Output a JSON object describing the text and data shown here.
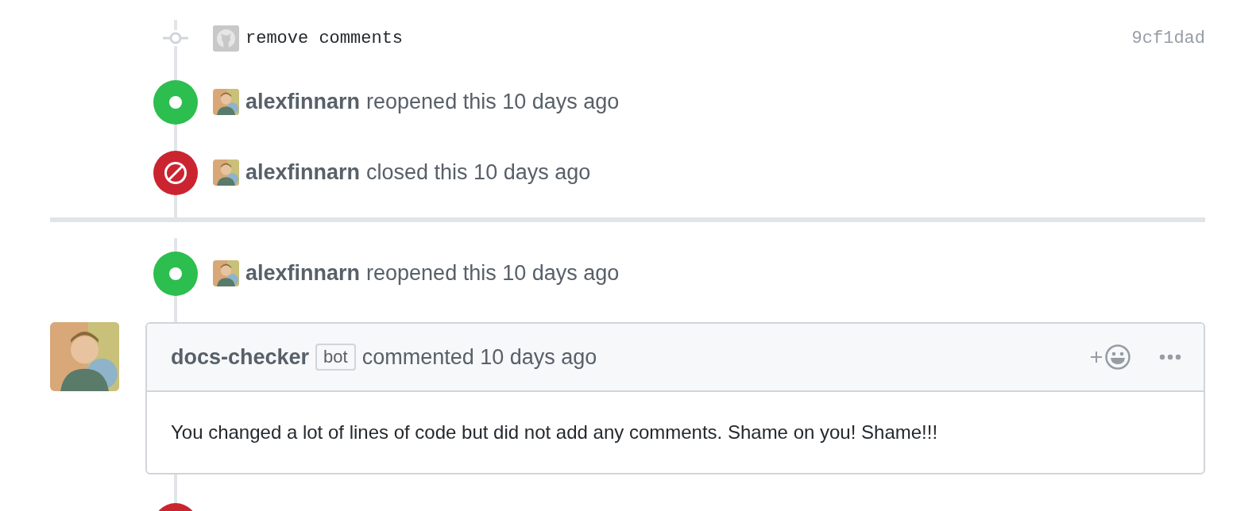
{
  "timeline": [
    {
      "kind": "commit",
      "message": "remove comments",
      "sha": "9cf1dad"
    },
    {
      "kind": "reopened",
      "actor": "alexfinnarn",
      "text": "reopened this 10 days ago"
    },
    {
      "kind": "closed",
      "actor": "alexfinnarn",
      "text": "closed this 10 days ago"
    },
    {
      "kind": "divider"
    },
    {
      "kind": "reopened",
      "actor": "alexfinnarn",
      "text": "reopened this 10 days ago"
    },
    {
      "kind": "comment",
      "author": "docs-checker",
      "label": "bot",
      "action": "commented 10 days ago",
      "body": "You changed a lot of lines of code but did not add any comments. Shame on you! Shame!!!"
    },
    {
      "kind": "closed"
    }
  ]
}
